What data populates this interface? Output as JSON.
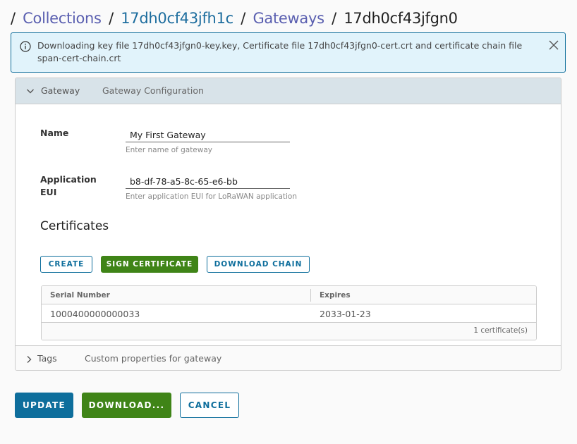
{
  "breadcrumb": {
    "items": [
      {
        "label": "Collections",
        "link": true
      },
      {
        "label": "17dh0cf43jfh1c",
        "link": true
      },
      {
        "label": "Gateways",
        "link": true
      },
      {
        "label": "17dh0cf43jfgn0",
        "link": false
      }
    ],
    "separator": "/"
  },
  "alert": {
    "icon": "info-icon",
    "message": "Downloading key file 17dh0cf43jfgn0-key.key, Certificate file 17dh0cf43jfgn0-cert.crt and certificate chain file span-cert-chain.crt",
    "close_icon": "close-icon"
  },
  "gateway_panel": {
    "title": "Gateway",
    "description": "Gateway Configuration",
    "expanded": true,
    "name": {
      "label": "Name",
      "value": "My First Gateway",
      "helper": "Enter name of gateway"
    },
    "eui": {
      "label_line1": "Application",
      "label_line2": "EUI",
      "value": "b8-df-78-a5-8c-65-e6-bb",
      "helper": "Enter application EUI for LoRaWAN application"
    },
    "certificates": {
      "title": "Certificates",
      "buttons": {
        "create": "CREATE",
        "sign": "SIGN CERTIFICATE",
        "download_chain": "DOWNLOAD CHAIN"
      },
      "table": {
        "columns": [
          "Serial Number",
          "Expires"
        ],
        "rows": [
          {
            "serial": "1000400000000033",
            "expires": "2033-01-23"
          }
        ],
        "footer": "1 certificate(s)"
      }
    }
  },
  "tags_panel": {
    "title": "Tags",
    "description": "Custom properties for gateway",
    "expanded": false
  },
  "actions": {
    "update": "UPDATE",
    "download": "DOWNLOAD...",
    "cancel": "CANCEL"
  },
  "colors": {
    "primary": "#0e6e9c",
    "success": "#3f8417",
    "alert_bg": "#e1f3fb",
    "panel_head_bg": "#d8e3e9",
    "link_purple": "#5a5fb0"
  }
}
